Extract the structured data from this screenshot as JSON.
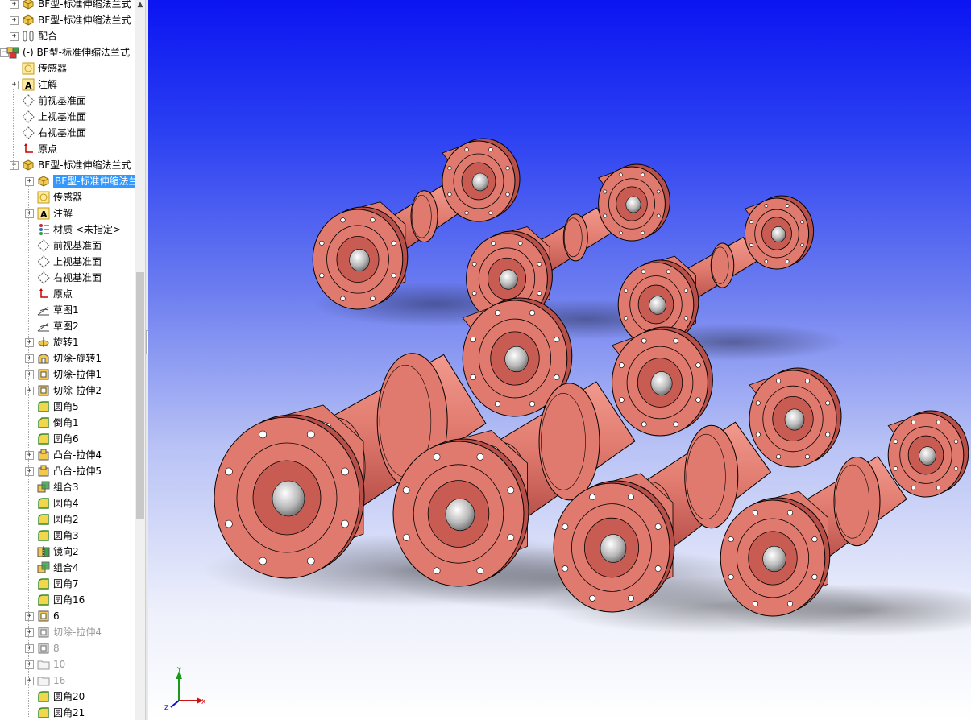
{
  "tree": {
    "items": [
      {
        "label": "BF型-标准伸缩法兰式",
        "icon": "part-icon",
        "expander": "+",
        "level": 0,
        "state": "normal"
      },
      {
        "label": "BF型-标准伸缩法兰式",
        "icon": "part-icon",
        "expander": "+",
        "level": 0,
        "state": "normal"
      },
      {
        "label": "配合",
        "icon": "mates-icon",
        "expander": "+",
        "level": 0,
        "state": "normal"
      },
      {
        "label": "(-) BF型-标准伸缩法兰式",
        "icon": "assembly-icon",
        "expander": "-",
        "level": -1,
        "state": "normal"
      },
      {
        "label": "传感器",
        "icon": "sensor-icon",
        "expander": "",
        "level": 0,
        "state": "normal"
      },
      {
        "label": "注解",
        "icon": "annotation-icon",
        "expander": "+",
        "level": 0,
        "state": "normal"
      },
      {
        "label": "前视基准面",
        "icon": "plane-icon",
        "expander": "",
        "level": 0,
        "state": "normal"
      },
      {
        "label": "上视基准面",
        "icon": "plane-icon",
        "expander": "",
        "level": 0,
        "state": "normal"
      },
      {
        "label": "右视基准面",
        "icon": "plane-icon",
        "expander": "",
        "level": 0,
        "state": "normal"
      },
      {
        "label": "原点",
        "icon": "origin-icon",
        "expander": "",
        "level": 0,
        "state": "normal"
      },
      {
        "label": "BF型-标准伸缩法兰式",
        "icon": "part-icon",
        "expander": "-",
        "level": 0,
        "state": "normal"
      },
      {
        "label": "BF型-标准伸缩法兰",
        "icon": "part-icon",
        "expander": "+",
        "level": 1,
        "state": "selected"
      },
      {
        "label": "传感器",
        "icon": "sensor-icon",
        "expander": "",
        "level": 1,
        "state": "normal"
      },
      {
        "label": "注解",
        "icon": "annotation-icon",
        "expander": "+",
        "level": 1,
        "state": "normal"
      },
      {
        "label": "材质 <未指定>",
        "icon": "material-icon",
        "expander": "",
        "level": 1,
        "state": "normal"
      },
      {
        "label": "前视基准面",
        "icon": "plane-icon",
        "expander": "",
        "level": 1,
        "state": "normal"
      },
      {
        "label": "上视基准面",
        "icon": "plane-icon",
        "expander": "",
        "level": 1,
        "state": "normal"
      },
      {
        "label": "右视基准面",
        "icon": "plane-icon",
        "expander": "",
        "level": 1,
        "state": "normal"
      },
      {
        "label": "原点",
        "icon": "origin-icon",
        "expander": "",
        "level": 1,
        "state": "normal"
      },
      {
        "label": "草图1",
        "icon": "sketch-icon",
        "expander": "",
        "level": 1,
        "state": "normal"
      },
      {
        "label": "草图2",
        "icon": "sketch-icon",
        "expander": "",
        "level": 1,
        "state": "normal"
      },
      {
        "label": "旋转1",
        "icon": "revolve-icon",
        "expander": "+",
        "level": 1,
        "state": "normal"
      },
      {
        "label": "切除-旋转1",
        "icon": "cut-revolve-icon",
        "expander": "+",
        "level": 1,
        "state": "normal"
      },
      {
        "label": "切除-拉伸1",
        "icon": "cut-extrude-icon",
        "expander": "+",
        "level": 1,
        "state": "normal"
      },
      {
        "label": "切除-拉伸2",
        "icon": "cut-extrude-icon",
        "expander": "+",
        "level": 1,
        "state": "normal"
      },
      {
        "label": "圆角5",
        "icon": "fillet-icon",
        "expander": "",
        "level": 1,
        "state": "normal"
      },
      {
        "label": "倒角1",
        "icon": "chamfer-icon",
        "expander": "",
        "level": 1,
        "state": "normal"
      },
      {
        "label": "圆角6",
        "icon": "fillet-icon",
        "expander": "",
        "level": 1,
        "state": "normal"
      },
      {
        "label": "凸台-拉伸4",
        "icon": "boss-extrude-icon",
        "expander": "+",
        "level": 1,
        "state": "normal"
      },
      {
        "label": "凸台-拉伸5",
        "icon": "boss-extrude-icon",
        "expander": "+",
        "level": 1,
        "state": "normal"
      },
      {
        "label": "组合3",
        "icon": "combine-icon",
        "expander": "",
        "level": 1,
        "state": "normal"
      },
      {
        "label": "圆角4",
        "icon": "fillet-icon",
        "expander": "",
        "level": 1,
        "state": "normal"
      },
      {
        "label": "圆角2",
        "icon": "fillet-icon",
        "expander": "",
        "level": 1,
        "state": "normal"
      },
      {
        "label": "圆角3",
        "icon": "fillet-icon",
        "expander": "",
        "level": 1,
        "state": "normal"
      },
      {
        "label": "镜向2",
        "icon": "mirror-icon",
        "expander": "",
        "level": 1,
        "state": "normal"
      },
      {
        "label": "组合4",
        "icon": "combine-icon",
        "expander": "",
        "level": 1,
        "state": "normal"
      },
      {
        "label": "圆角7",
        "icon": "fillet-icon",
        "expander": "",
        "level": 1,
        "state": "normal"
      },
      {
        "label": "圆角16",
        "icon": "fillet-icon",
        "expander": "",
        "level": 1,
        "state": "normal"
      },
      {
        "label": "6",
        "icon": "cut-extrude-icon",
        "expander": "+",
        "level": 1,
        "state": "normal"
      },
      {
        "label": "切除-拉伸4",
        "icon": "cut-extrude-gray-icon",
        "expander": "+",
        "level": 1,
        "state": "suppressed"
      },
      {
        "label": "8",
        "icon": "cut-extrude-gray-icon",
        "expander": "+",
        "level": 1,
        "state": "suppressed"
      },
      {
        "label": "10",
        "icon": "folder-icon",
        "expander": "+",
        "level": 1,
        "state": "suppressed"
      },
      {
        "label": "16",
        "icon": "folder-icon",
        "expander": "+",
        "level": 1,
        "state": "suppressed"
      },
      {
        "label": "圆角20",
        "icon": "fillet-icon",
        "expander": "",
        "level": 1,
        "state": "normal"
      },
      {
        "label": "圆角21",
        "icon": "fillet-icon",
        "expander": "",
        "level": 1,
        "state": "normal"
      }
    ]
  },
  "triad": {
    "x_label": "X",
    "y_label": "Y",
    "z_label": "Z"
  },
  "colors": {
    "part": "#e07a6e",
    "part_dark": "#b8504a",
    "selection": "#3399ff",
    "viewport_top": "#0b14f2"
  }
}
